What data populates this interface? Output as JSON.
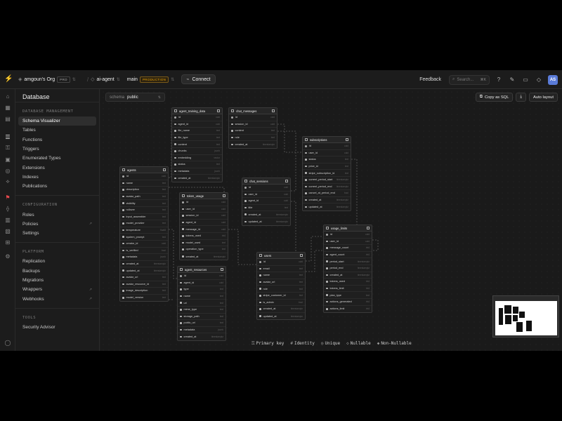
{
  "topbar": {
    "org": "amgoun's Org",
    "org_plan": "PRO",
    "project": "ai-agent",
    "branch": "main",
    "branch_badge": "PRODUCTION",
    "connect": "Connect",
    "feedback": "Feedback",
    "search_placeholder": "Search...",
    "search_kbd": "⌘K",
    "avatar_initials": "AS"
  },
  "sidebar": {
    "title": "Database",
    "sections": [
      {
        "heading": "DATABASE MANAGEMENT",
        "items": [
          {
            "label": "Schema Visualizer",
            "active": true
          },
          {
            "label": "Tables"
          },
          {
            "label": "Functions"
          },
          {
            "label": "Triggers"
          },
          {
            "label": "Enumerated Types"
          },
          {
            "label": "Extensions"
          },
          {
            "label": "Indexes"
          },
          {
            "label": "Publications"
          }
        ]
      },
      {
        "heading": "CONFIGURATION",
        "items": [
          {
            "label": "Roles"
          },
          {
            "label": "Policies",
            "external": true
          },
          {
            "label": "Settings"
          }
        ]
      },
      {
        "heading": "PLATFORM",
        "items": [
          {
            "label": "Replication"
          },
          {
            "label": "Backups"
          },
          {
            "label": "Migrations"
          },
          {
            "label": "Wrappers",
            "external": true
          },
          {
            "label": "Webhooks",
            "external": true
          }
        ]
      },
      {
        "heading": "TOOLS",
        "items": [
          {
            "label": "Security Advisor"
          }
        ]
      }
    ]
  },
  "canvas": {
    "schema_label": "schema",
    "schema_value": "public",
    "copy_sql": "Copy as SQL",
    "auto_layout": "Auto layout",
    "legend": [
      {
        "icon": "key-icon",
        "glyph": "⚿",
        "label": "Primary key"
      },
      {
        "icon": "hash-icon",
        "glyph": "#",
        "label": "Identity"
      },
      {
        "icon": "fingerprint-icon",
        "glyph": "◎",
        "label": "Unique"
      },
      {
        "icon": "diamond-outline-icon",
        "glyph": "◇",
        "label": "Nullable"
      },
      {
        "icon": "diamond-filled-icon",
        "glyph": "◆",
        "label": "Non-Nullable"
      }
    ]
  },
  "tables": [
    {
      "name": "agent_training_data",
      "columns": [
        [
          "id",
          "uuid"
        ],
        [
          "agent_id",
          "uuid"
        ],
        [
          "file_name",
          "text"
        ],
        [
          "file_type",
          "text"
        ],
        [
          "content",
          "text"
        ],
        [
          "chunks",
          "jsonb"
        ],
        [
          "embedding",
          "vector"
        ],
        [
          "status",
          "text"
        ],
        [
          "metadata",
          "jsonb"
        ],
        [
          "created_at",
          "timestamptz"
        ]
      ]
    },
    {
      "name": "chat_messages",
      "columns": [
        [
          "id",
          "uuid"
        ],
        [
          "session_id",
          "uuid"
        ],
        [
          "content",
          "text"
        ],
        [
          "role",
          "text"
        ],
        [
          "created_at",
          "timestamptz"
        ]
      ]
    },
    {
      "name": "subscriptions",
      "columns": [
        [
          "id",
          "uuid"
        ],
        [
          "user_id",
          "uuid"
        ],
        [
          "status",
          "text"
        ],
        [
          "price_id",
          "text"
        ],
        [
          "stripe_subscription_id",
          "text"
        ],
        [
          "current_period_start",
          "timestamptz"
        ],
        [
          "current_period_end",
          "timestamptz"
        ],
        [
          "cancel_at_period_end",
          "bool"
        ],
        [
          "created_at",
          "timestamptz"
        ],
        [
          "updated_at",
          "timestamptz"
        ]
      ]
    },
    {
      "name": "agents",
      "columns": [
        [
          "id",
          "uuid"
        ],
        [
          "name",
          "text"
        ],
        [
          "description",
          "text"
        ],
        [
          "avatar_path",
          "text"
        ],
        [
          "visibility",
          "text"
        ],
        [
          "rollover",
          "text"
        ],
        [
          "input_assembler",
          "text"
        ],
        [
          "model_provider",
          "text"
        ],
        [
          "temperature",
          "float8"
        ],
        [
          "system_prompt",
          "text"
        ],
        [
          "creator_id",
          "uuid"
        ],
        [
          "is_verified",
          "bool"
        ],
        [
          "metadata",
          "jsonb"
        ],
        [
          "created_at",
          "timestamptz"
        ],
        [
          "updated_at",
          "timestamptz"
        ],
        [
          "avatar_url",
          "text"
        ],
        [
          "avatar_resource_id",
          "text"
        ],
        [
          "image_description",
          "text"
        ],
        [
          "model_version",
          "text"
        ]
      ]
    },
    {
      "name": "token_usage",
      "columns": [
        [
          "id",
          "uuid"
        ],
        [
          "user_id",
          "uuid"
        ],
        [
          "session_id",
          "uuid"
        ],
        [
          "agent_id",
          "uuid"
        ],
        [
          "message_id",
          "uuid"
        ],
        [
          "tokens_used",
          "int4"
        ],
        [
          "model_used",
          "text"
        ],
        [
          "operation_type",
          "text"
        ],
        [
          "created_at",
          "timestamptz"
        ]
      ]
    },
    {
      "name": "chat_sessions",
      "columns": [
        [
          "id",
          "uuid"
        ],
        [
          "user_id",
          "uuid"
        ],
        [
          "agent_id",
          "uuid"
        ],
        [
          "title",
          "text"
        ],
        [
          "created_at",
          "timestamptz"
        ],
        [
          "updated_at",
          "timestamptz"
        ]
      ]
    },
    {
      "name": "usage_limits",
      "columns": [
        [
          "id",
          "uuid"
        ],
        [
          "user_id",
          "uuid"
        ],
        [
          "message_count",
          "int4"
        ],
        [
          "agent_count",
          "int4"
        ],
        [
          "period_start",
          "timestamptz"
        ],
        [
          "period_end",
          "timestamptz"
        ],
        [
          "created_at",
          "timestamptz"
        ],
        [
          "tokens_used",
          "int4"
        ],
        [
          "tokens_limit",
          "int4"
        ],
        [
          "plan_type",
          "text"
        ],
        [
          "actions_generated",
          "int4"
        ],
        [
          "actions_limit",
          "int4"
        ]
      ]
    },
    {
      "name": "users",
      "columns": [
        [
          "id",
          "uuid"
        ],
        [
          "email",
          "text"
        ],
        [
          "name",
          "text"
        ],
        [
          "avatar_url",
          "text"
        ],
        [
          "role",
          "text"
        ],
        [
          "stripe_customer_id",
          "text"
        ],
        [
          "is_admin",
          "bool"
        ],
        [
          "created_at",
          "timestamptz"
        ],
        [
          "updated_at",
          "timestamptz"
        ]
      ]
    },
    {
      "name": "agent_resources",
      "columns": [
        [
          "id",
          "uuid"
        ],
        [
          "agent_id",
          "uuid"
        ],
        [
          "type",
          "text"
        ],
        [
          "name",
          "text"
        ],
        [
          "url",
          "text"
        ],
        [
          "mime_type",
          "text"
        ],
        [
          "storage_path",
          "text"
        ],
        [
          "public_url",
          "text"
        ],
        [
          "metadata",
          "jsonb"
        ],
        [
          "created_at",
          "timestamptz"
        ]
      ]
    }
  ]
}
